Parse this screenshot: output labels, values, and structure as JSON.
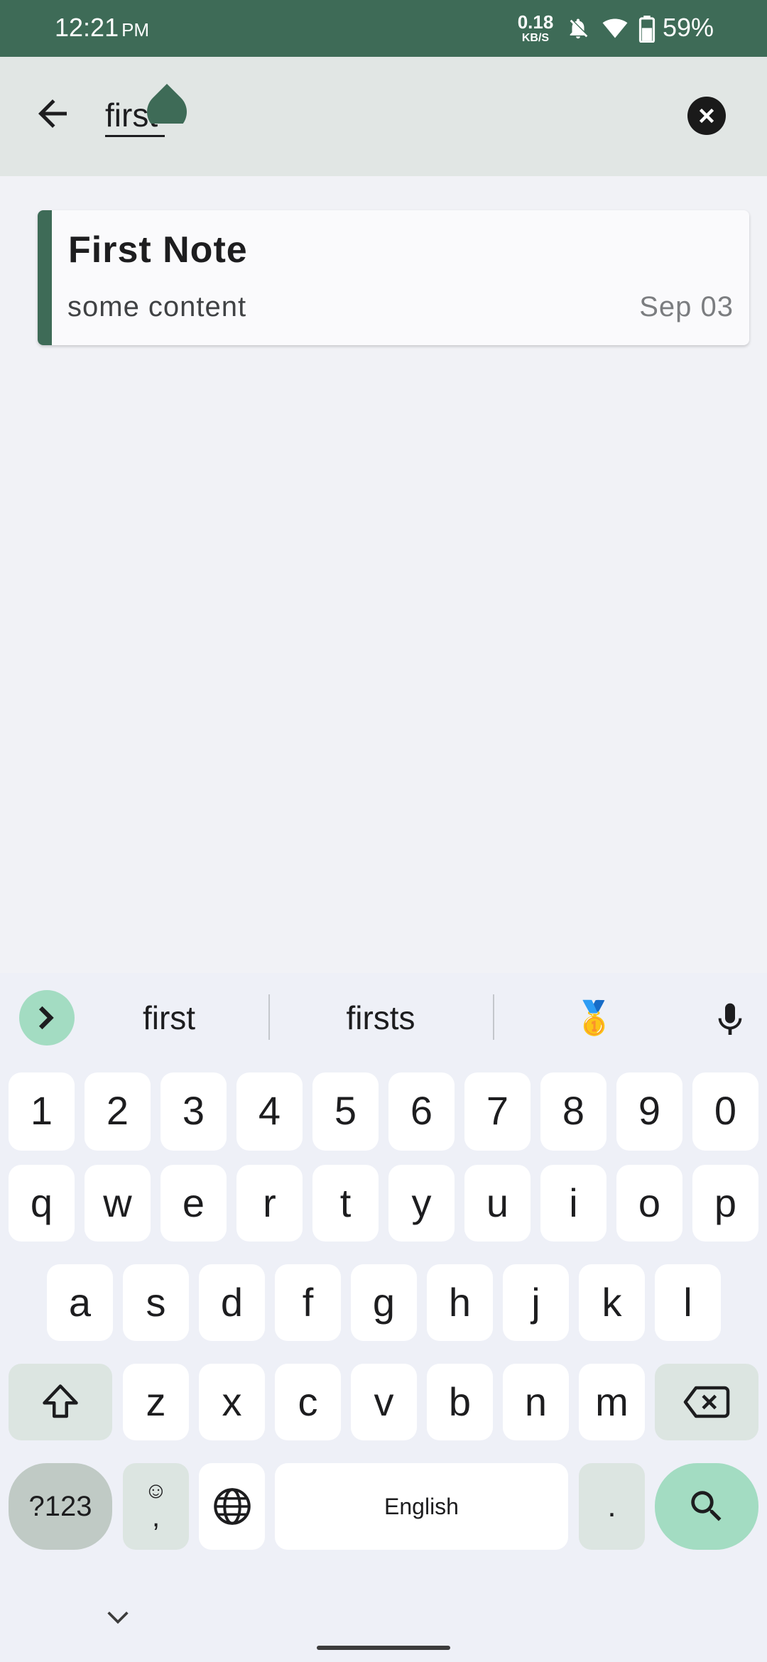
{
  "status_bar": {
    "time": "12:21",
    "ampm": "PM",
    "net_speed_value": "0.18",
    "net_speed_unit": "KB/S",
    "battery_percent": "59%",
    "icons": [
      "bell-off-icon",
      "wifi-icon",
      "battery-icon"
    ]
  },
  "search": {
    "query": "first",
    "back_icon": "arrow-left-icon",
    "clear_icon": "close-circle-icon"
  },
  "results": [
    {
      "title": "First Note",
      "body": "some content",
      "date": "Sep 03"
    }
  ],
  "keyboard": {
    "suggestions": [
      "first",
      "firsts",
      "🥇"
    ],
    "row_numbers": [
      "1",
      "2",
      "3",
      "4",
      "5",
      "6",
      "7",
      "8",
      "9",
      "0"
    ],
    "row_q": [
      "q",
      "w",
      "e",
      "r",
      "t",
      "y",
      "u",
      "i",
      "o",
      "p"
    ],
    "row_a": [
      "a",
      "s",
      "d",
      "f",
      "g",
      "h",
      "j",
      "k",
      "l"
    ],
    "row_z": [
      "z",
      "x",
      "c",
      "v",
      "b",
      "n",
      "m"
    ],
    "symbols_label": "?123",
    "emoji_key_top": "☺",
    "emoji_key_bottom": ",",
    "space_label": "English",
    "period_label": "."
  },
  "colors": {
    "accent": "#3E6B57",
    "search_bar_bg": "#E1E6E4",
    "page_bg": "#F1F2F6",
    "key_accent": "#A3DCC2"
  }
}
